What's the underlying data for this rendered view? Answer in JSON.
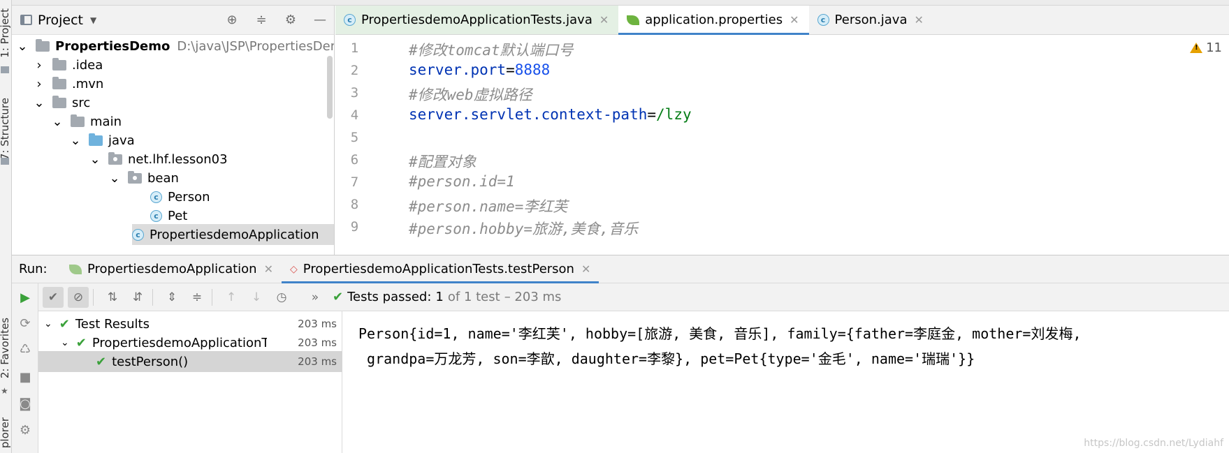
{
  "left_strip": {
    "project_label": "1: Project",
    "structure_label": "7: Structure",
    "favorites_label": "2: Favorites",
    "explorer_label": "plorer"
  },
  "project_panel": {
    "title": "Project",
    "tree": [
      {
        "label": "PropertiesDemo",
        "hint": "D:\\java\\JSP\\PropertiesDemo",
        "type": "module",
        "expanded": true
      },
      {
        "label": ".idea",
        "type": "folder",
        "expanded": false
      },
      {
        "label": ".mvn",
        "type": "folder",
        "expanded": false
      },
      {
        "label": "src",
        "type": "folder",
        "expanded": true
      },
      {
        "label": "main",
        "type": "folder",
        "expanded": true
      },
      {
        "label": "java",
        "type": "source-folder",
        "expanded": true
      },
      {
        "label": "net.lhf.lesson03",
        "type": "package",
        "expanded": true
      },
      {
        "label": "bean",
        "type": "package",
        "expanded": true
      },
      {
        "label": "Person",
        "type": "class"
      },
      {
        "label": "Pet",
        "type": "class"
      },
      {
        "label": "PropertiesdemoApplication",
        "type": "class"
      }
    ]
  },
  "editor": {
    "tabs": [
      {
        "label": "PropertiesdemoApplicationTests.java",
        "icon": "test-class-icon"
      },
      {
        "label": "application.properties",
        "icon": "spring-leaf-icon",
        "active": true
      },
      {
        "label": "Person.java",
        "icon": "class-icon"
      }
    ],
    "warning_count": "11",
    "lines": [
      {
        "n": "1",
        "comment": "#修改tomcat默认端口号"
      },
      {
        "n": "2",
        "key": "server.port",
        "eq": "=",
        "value": "8888",
        "value_kind": "num"
      },
      {
        "n": "3",
        "comment": "#修改web虚拟路径"
      },
      {
        "n": "4",
        "key": "server.servlet.context-path",
        "eq": "=",
        "value": "/lzy",
        "value_kind": "str"
      },
      {
        "n": "5"
      },
      {
        "n": "6",
        "comment": "#配置对象"
      },
      {
        "n": "7",
        "comment": "#person.id=1"
      },
      {
        "n": "8",
        "comment": "#person.name=李红芙"
      },
      {
        "n": "9",
        "comment": "#person.hobby=旅游,美食,音乐"
      }
    ]
  },
  "run_panel": {
    "label": "Run:",
    "tabs": [
      {
        "label": "PropertiesdemoApplication"
      },
      {
        "label": "PropertiesdemoApplicationTests.testPerson",
        "active": true
      }
    ],
    "status": {
      "passed": "Tests passed:",
      "count": "1",
      "of": "of 1 test",
      "duration": "– 203 ms"
    },
    "results": [
      {
        "label": "Test Results",
        "duration": "203 ms"
      },
      {
        "label": "PropertiesdemoApplicationTests",
        "duration": "203 ms"
      },
      {
        "label": "testPerson()",
        "duration": "203 ms",
        "selected": true
      }
    ],
    "console": [
      "Person{id=1, name='李红芙', hobby=[旅游, 美食, 音乐], family={father=李庭金, mother=刘发梅,",
      " grandpa=万龙芳, son=李歆, daughter=李黎}, pet=Pet{type='金毛', name='瑞瑞'}}"
    ],
    "watermark": "https://blog.csdn.net/Lydiahf"
  },
  "colors": {
    "accent": "#4083c9",
    "pass_green": "#3aa13a",
    "keyword_blue": "#0033b3",
    "number_blue": "#1750eb",
    "string_green": "#067d17",
    "comment_gray": "#8c8c8c"
  }
}
